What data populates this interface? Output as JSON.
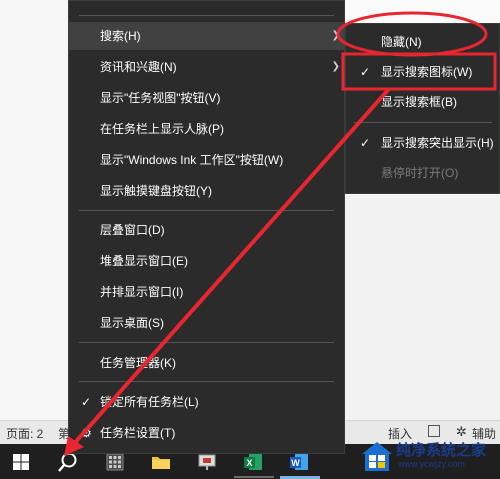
{
  "statusbar": {
    "page": "页面: 2",
    "page_cut": "第",
    "insert": "插入",
    "accessibility": "辅助功"
  },
  "menu": {
    "items": [
      {
        "label": "搜索(H)",
        "has_submenu": true,
        "hover": true
      },
      {
        "label": "资讯和兴趣(N)",
        "has_submenu": true
      },
      {
        "label": "显示\"任务视图\"按钮(V)"
      },
      {
        "label": "在任务栏上显示人脉(P)"
      },
      {
        "label": "显示\"Windows Ink 工作区\"按钮(W)"
      },
      {
        "label": "显示触摸键盘按钮(Y)"
      },
      {
        "label": "层叠窗口(D)"
      },
      {
        "label": "堆叠显示窗口(E)"
      },
      {
        "label": "并排显示窗口(I)"
      },
      {
        "label": "显示桌面(S)"
      },
      {
        "label": "任务管理器(K)"
      },
      {
        "label": "锁定所有任务栏(L)",
        "checked": true
      },
      {
        "label": "任务栏设置(T)"
      }
    ]
  },
  "submenu": {
    "items": [
      {
        "label": "隐藏(N)"
      },
      {
        "label": "显示搜索图标(W)",
        "checked": true
      },
      {
        "label": "显示搜索框(B)"
      },
      {
        "label": "显示搜索突出显示(H)",
        "checked": true
      },
      {
        "label": "悬停时打开(O)",
        "disabled": true
      }
    ]
  },
  "taskbar": {
    "icons": [
      "windows-start-icon",
      "search-icon",
      "calculator-icon",
      "file-explorer-icon",
      "presentation-app-icon",
      "excel-icon",
      "word-icon"
    ]
  },
  "watermark": {
    "name": "纯净系统之家",
    "url": "www.ycwjzy.com"
  },
  "colors": {
    "menu_bg": "#2b2b2b",
    "hover_bg": "#414141",
    "annotation_red": "#e8262f",
    "taskbar_bg": "#1f1f1f"
  }
}
